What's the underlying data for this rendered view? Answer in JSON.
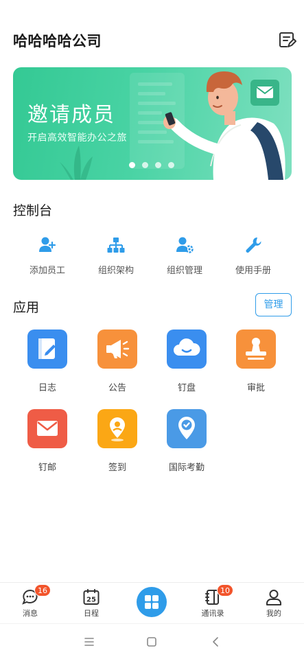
{
  "header": {
    "company_name": "哈哈哈哈公司",
    "edit_icon": "edit-list-icon"
  },
  "banner": {
    "title": "邀请成员",
    "subtitle": "开启高效智能办公之旅",
    "slide_count": 4,
    "active_slide": 1,
    "colors": {
      "background": "#3ccd99"
    }
  },
  "console": {
    "title": "控制台",
    "items": [
      {
        "label": "添加员工",
        "icon": "add-user-icon"
      },
      {
        "label": "组织架构",
        "icon": "org-chart-icon"
      },
      {
        "label": "组织管理",
        "icon": "user-settings-icon"
      },
      {
        "label": "使用手册",
        "icon": "wrench-icon"
      }
    ],
    "icon_color": "#2f9ce9"
  },
  "apps": {
    "title": "应用",
    "manage_label": "管理",
    "items": [
      {
        "label": "日志",
        "icon": "journal-icon",
        "color": "#3a8eef"
      },
      {
        "label": "公告",
        "icon": "megaphone-icon",
        "color": "#f7913b"
      },
      {
        "label": "钉盘",
        "icon": "cloud-icon",
        "color": "#3a8eef"
      },
      {
        "label": "审批",
        "icon": "stamp-icon",
        "color": "#f7913b"
      },
      {
        "label": "钉邮",
        "icon": "mail-icon",
        "color": "#ef5c46"
      },
      {
        "label": "签到",
        "icon": "location-pin-icon",
        "color": "#fba715"
      },
      {
        "label": "国际考勤",
        "icon": "check-shield-icon",
        "color": "#4a9ae6"
      }
    ]
  },
  "tabbar": {
    "items": [
      {
        "label": "消息",
        "icon": "chat-icon",
        "badge": "16"
      },
      {
        "label": "日程",
        "icon": "calendar-icon",
        "calendar_day": "25"
      },
      {
        "label": "",
        "icon": "workbench-grid-icon"
      },
      {
        "label": "通讯录",
        "icon": "contacts-book-icon",
        "badge": "10"
      },
      {
        "label": "我的",
        "icon": "profile-icon"
      }
    ],
    "accent_color": "#2f9ce9",
    "badge_color": "#f2552c"
  },
  "system_nav": {
    "items": [
      "menu-icon",
      "home-icon",
      "back-icon"
    ]
  }
}
